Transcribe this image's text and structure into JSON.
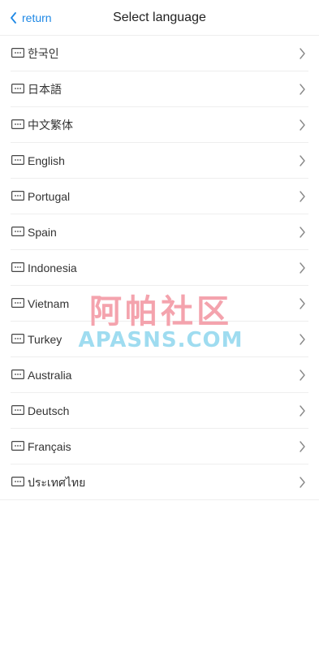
{
  "header": {
    "back_label": "return",
    "title": "Select language"
  },
  "languages": [
    {
      "label": "한국인",
      "icon": "keyboard-icon"
    },
    {
      "label": "日本語",
      "icon": "keyboard-icon"
    },
    {
      "label": "中文繁体",
      "icon": "keyboard-icon"
    },
    {
      "label": "English",
      "icon": "keyboard-icon"
    },
    {
      "label": "Portugal",
      "icon": "keyboard-icon"
    },
    {
      "label": "Spain",
      "icon": "keyboard-icon"
    },
    {
      "label": "Indonesia",
      "icon": "keyboard-icon"
    },
    {
      "label": "Vietnam",
      "icon": "keyboard-icon"
    },
    {
      "label": "Turkey",
      "icon": "keyboard-icon"
    },
    {
      "label": "Australia",
      "icon": "keyboard-icon"
    },
    {
      "label": "Deutsch",
      "icon": "keyboard-icon"
    },
    {
      "label": "Français",
      "icon": "keyboard-icon"
    },
    {
      "label": "ประเทศไทย",
      "icon": "keyboard-icon"
    }
  ],
  "watermark": {
    "chinese": "阿帕社区",
    "english": "APASNS.COM"
  },
  "colors": {
    "accent": "#1e88e5",
    "divider": "#eeeeee",
    "watermark_pink": "#f4a3ad",
    "watermark_blue": "#9fdcf0"
  }
}
